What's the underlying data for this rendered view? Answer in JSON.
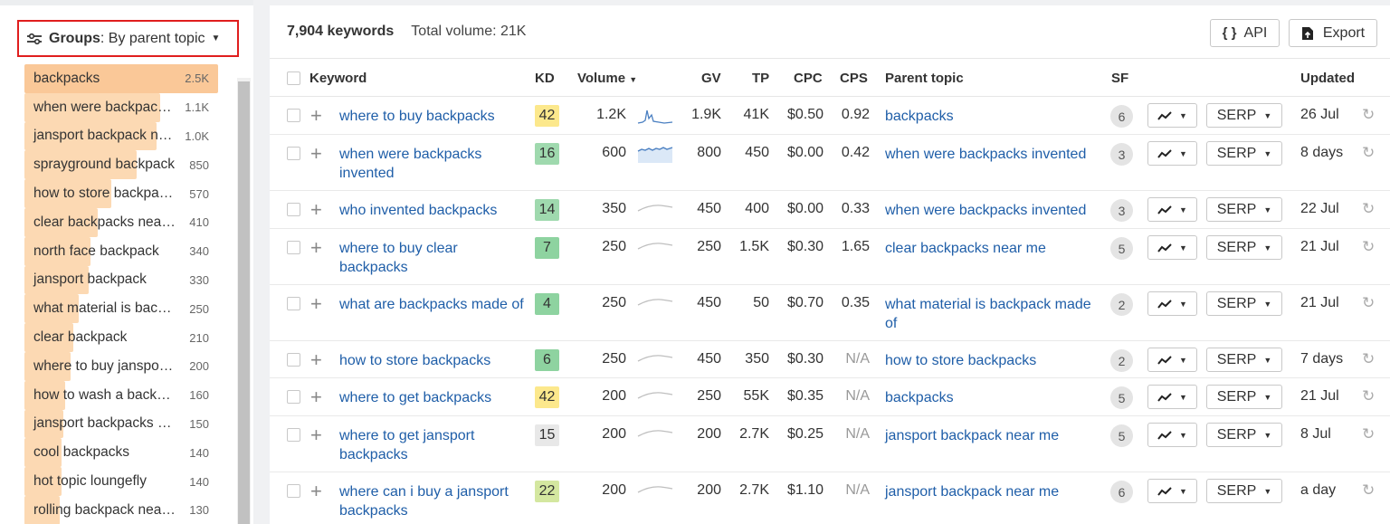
{
  "groups": {
    "label": "Groups",
    "value": ": By parent topic",
    "items": [
      {
        "name": "backpacks",
        "count": "2.5K",
        "fill": 1.0
      },
      {
        "name": "when were backpacks invented",
        "count": "1.1K",
        "fill": 0.7
      },
      {
        "name": "jansport backpack near me",
        "count": "1.0K",
        "fill": 0.68
      },
      {
        "name": "sprayground backpack",
        "count": "850",
        "fill": 0.58
      },
      {
        "name": "how to store backpacks",
        "count": "570",
        "fill": 0.45
      },
      {
        "name": "clear backpacks near me",
        "count": "410",
        "fill": 0.38
      },
      {
        "name": "north face backpack",
        "count": "340",
        "fill": 0.34
      },
      {
        "name": "jansport backpack",
        "count": "330",
        "fill": 0.33
      },
      {
        "name": "what material is backpack made of",
        "count": "250",
        "fill": 0.28
      },
      {
        "name": "clear backpack",
        "count": "210",
        "fill": 0.25
      },
      {
        "name": "where to buy jansport backpacks",
        "count": "200",
        "fill": 0.24
      },
      {
        "name": "how to wash a backpack",
        "count": "160",
        "fill": 0.21
      },
      {
        "name": "jansport backpacks near me",
        "count": "150",
        "fill": 0.2
      },
      {
        "name": "cool backpacks",
        "count": "140",
        "fill": 0.19
      },
      {
        "name": "hot topic loungefly",
        "count": "140",
        "fill": 0.19
      },
      {
        "name": "rolling backpack near me",
        "count": "130",
        "fill": 0.18
      }
    ]
  },
  "summary": {
    "keywords": "7,904 keywords",
    "total_volume": "Total volume: 21K"
  },
  "buttons": {
    "api_icon": "{ }",
    "api": "API",
    "export": "Export"
  },
  "columns": {
    "keyword": "Keyword",
    "kd": "KD",
    "volume": "Volume",
    "volume_sort": "▼",
    "gv": "GV",
    "tp": "TP",
    "cpc": "CPC",
    "cps": "CPS",
    "parent_topic": "Parent topic",
    "sf": "SF",
    "updated": "Updated"
  },
  "rows": [
    {
      "keyword": "where to buy backpacks",
      "kd": "42",
      "kd_color": "#fce88c",
      "volume": "1.2K",
      "gv": "1.9K",
      "tp": "41K",
      "cpc": "$0.50",
      "cps": "0.92",
      "parent": "backpacks",
      "sf": "6",
      "serp": "SERP",
      "updated": "26 Jul",
      "spark": "spike"
    },
    {
      "keyword": "when were backpacks invented",
      "kd": "16",
      "kd_color": "#9fd9ae",
      "volume": "600",
      "gv": "800",
      "tp": "450",
      "cpc": "$0.00",
      "cps": "0.42",
      "parent": "when were backpacks invented",
      "sf": "3",
      "serp": "SERP",
      "updated": "8 days",
      "spark": "plateau"
    },
    {
      "keyword": "who invented backpacks",
      "kd": "14",
      "kd_color": "#9fd9ae",
      "volume": "350",
      "gv": "450",
      "tp": "400",
      "cpc": "$0.00",
      "cps": "0.33",
      "parent": "when were backpacks invented",
      "sf": "3",
      "serp": "SERP",
      "updated": "22 Jul",
      "spark": "flat"
    },
    {
      "keyword": "where to buy clear backpacks",
      "kd": "7",
      "kd_color": "#8ed3a0",
      "volume": "250",
      "gv": "250",
      "tp": "1.5K",
      "cpc": "$0.30",
      "cps": "1.65",
      "parent": "clear backpacks near me",
      "sf": "5",
      "serp": "SERP",
      "updated": "21 Jul",
      "spark": "flat"
    },
    {
      "keyword": "what are backpacks made of",
      "kd": "4",
      "kd_color": "#8ed3a0",
      "volume": "250",
      "gv": "450",
      "tp": "50",
      "cpc": "$0.70",
      "cps": "0.35",
      "parent": "what material is backpack made of",
      "sf": "2",
      "serp": "SERP",
      "updated": "21 Jul",
      "spark": "flat"
    },
    {
      "keyword": "how to store backpacks",
      "kd": "6",
      "kd_color": "#8ed3a0",
      "volume": "250",
      "gv": "450",
      "tp": "350",
      "cpc": "$0.30",
      "cps": "N/A",
      "parent": "how to store backpacks",
      "sf": "2",
      "serp": "SERP",
      "updated": "7 days",
      "spark": "flat"
    },
    {
      "keyword": "where to get backpacks",
      "kd": "42",
      "kd_color": "#fce88c",
      "volume": "200",
      "gv": "250",
      "tp": "55K",
      "cpc": "$0.35",
      "cps": "N/A",
      "parent": "backpacks",
      "sf": "5",
      "serp": "SERP",
      "updated": "21 Jul",
      "spark": "flat"
    },
    {
      "keyword": "where to get jansport backpacks",
      "kd": "15",
      "kd_color": "#e8e8e8",
      "volume": "200",
      "gv": "200",
      "tp": "2.7K",
      "cpc": "$0.25",
      "cps": "N/A",
      "parent": "jansport backpack near me",
      "sf": "5",
      "serp": "SERP",
      "updated": "8 Jul",
      "spark": "flat"
    },
    {
      "keyword": "where can i buy a jansport backpacks",
      "kd": "22",
      "kd_color": "#d4e7a0",
      "volume": "200",
      "gv": "200",
      "tp": "2.7K",
      "cpc": "$1.10",
      "cps": "N/A",
      "parent": "jansport backpack near me",
      "sf": "6",
      "serp": "SERP",
      "updated": "a day",
      "spark": "flat"
    }
  ],
  "icons": {
    "groups": "sliders-icon",
    "plus": "plus-icon",
    "trend": "trend-icon",
    "refresh": "refresh-icon",
    "export": "export-icon"
  },
  "colors": {
    "link": "#1f5ea8",
    "highlight": "#e01e1e",
    "bar": "#fcd9b3"
  }
}
